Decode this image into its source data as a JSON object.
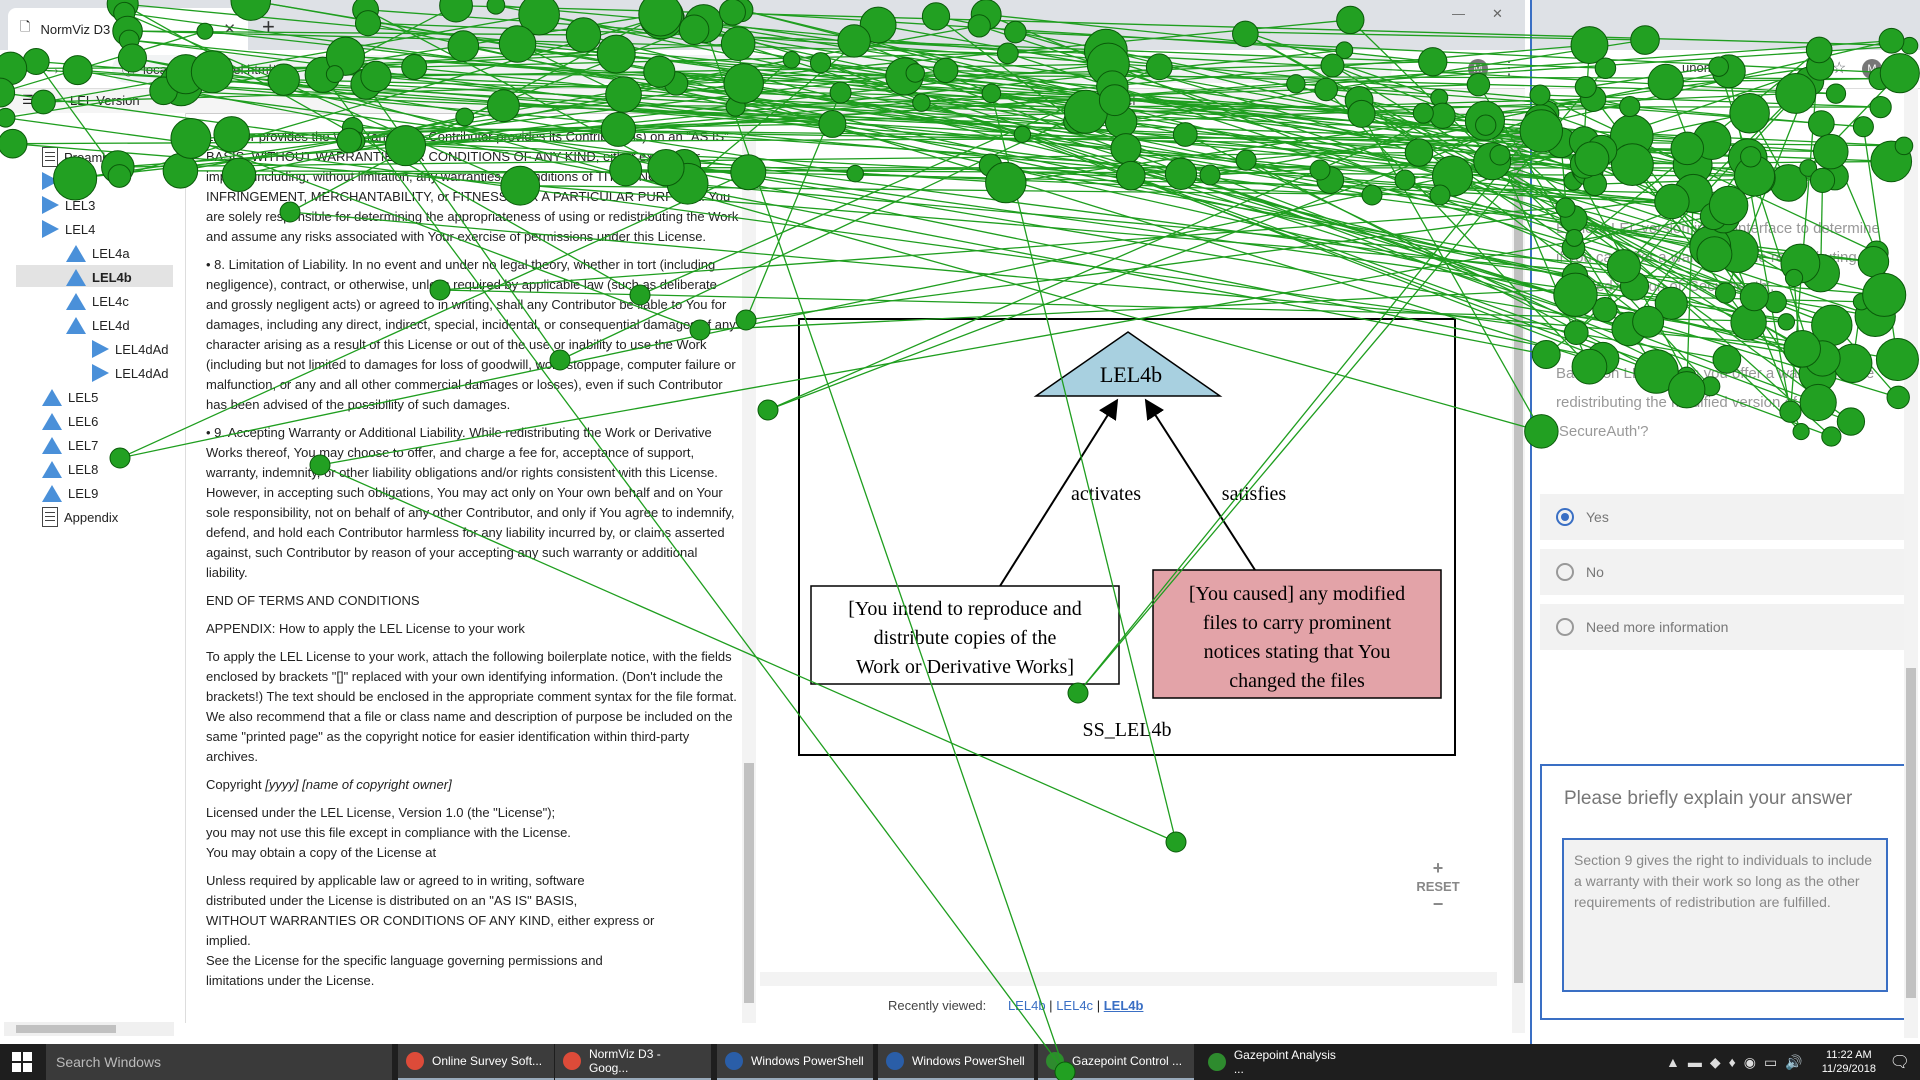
{
  "left_window": {
    "tab_title": "NormViz D3",
    "url": "localhost:3000/lel.html#",
    "profile_initial": "M",
    "app_title": "LEL Version",
    "panel_title": "Model",
    "tree": [
      {
        "label": "Preamble",
        "icon": "doc-icon"
      },
      {
        "label": "LEL2",
        "icon": "triangle-right-icon"
      },
      {
        "label": "LEL3",
        "icon": "triangle-right-icon"
      },
      {
        "label": "LEL4",
        "icon": "triangle-right-icon"
      },
      {
        "label": "LEL4a",
        "icon": "triangle-up-icon"
      },
      {
        "label": "LEL4b",
        "icon": "triangle-up-icon",
        "selected": true
      },
      {
        "label": "LEL4c",
        "icon": "triangle-up-icon"
      },
      {
        "label": "LEL4d",
        "icon": "triangle-up-icon"
      },
      {
        "label": "LEL4dAd",
        "icon": "triangle-right-icon"
      },
      {
        "label": "LEL4dAd",
        "icon": "triangle-right-icon"
      },
      {
        "label": "LEL5",
        "icon": "triangle-up-icon"
      },
      {
        "label": "LEL6",
        "icon": "triangle-up-icon"
      },
      {
        "label": "LEL7",
        "icon": "triangle-up-icon"
      },
      {
        "label": "LEL8",
        "icon": "triangle-up-icon"
      },
      {
        "label": "LEL9",
        "icon": "triangle-up-icon"
      },
      {
        "label": "Appendix",
        "icon": "doc-icon"
      }
    ],
    "license": {
      "p1": "Licensor provides the Work (and each Contributor provides its Contributions) on an \"AS IS\" BASIS, WITHOUT WARRANTIES OR CONDITIONS OF ANY KIND, either express or implied, including, without limitation, any warranties or conditions of TITLE, NON-INFRINGEMENT, MERCHANTABILITY, or FITNESS FOR A PARTICULAR PURPOSE. You are solely responsible for determining the appropriateness of using or redistributing the Work and assume any risks associated with Your exercise of permissions under this License.",
      "p8": "8. Limitation of Liability. In no event and under no legal theory, whether in tort (including negligence), contract, or otherwise, unless required by applicable law (such as deliberate and grossly negligent acts) or agreed to in writing, shall any Contributor be liable to You for damages, including any direct, indirect, special, incidental, or consequential damages of any character arising as a result of this License or out of the use or inability to use the Work (including but not limited to damages for loss of goodwill, work stoppage, computer failure or malfunction, or any and all other commercial damages or losses), even if such Contributor has been advised of the possibility of such damages.",
      "p9": "9. Accepting Warranty or Additional Liability. While redistributing the Work or Derivative Works thereof, You may choose to offer, and charge a fee for, acceptance of support, warranty, indemnity, or other liability obligations and/or rights consistent with this License. However, in accepting such obligations, You may act only on Your own behalf and on Your sole responsibility, not on behalf of any other Contributor, and only if You agree to indemnify, defend, and hold each Contributor harmless for any liability incurred by, or claims asserted against, such Contributor by reason of your accepting any such warranty or additional liability.",
      "end": "END OF TERMS AND CONDITIONS",
      "appendix_head": "APPENDIX: How to apply the LEL License to your work",
      "appendix_body": "To apply the LEL License to your work, attach the following boilerplate notice, with the fields enclosed by brackets \"[]\" replaced with your own identifying information. (Don't include the brackets!) The text should be enclosed in the appropriate comment syntax for the file format. We also recommend that a file or class name and description of purpose be included on the same \"printed page\" as the copyright notice for easier identification within third-party archives.",
      "copyright_label": "Copyright",
      "copyright_value": "[yyyy] [name of copyright owner]",
      "licensed_1": "Licensed under the LEL License, Version 1.0 (the \"License\");",
      "licensed_2": "you may not use this file except in compliance with the License.",
      "licensed_3": "You may obtain a copy of the License at",
      "unless_1": "Unless required by applicable law or agreed to in writing, software",
      "unless_2": "distributed under the License is distributed on an \"AS IS\" BASIS,",
      "unless_3": "WITHOUT WARRANTIES OR CONDITIONS OF ANY KIND, either express or",
      "unless_4": "implied.",
      "unless_5": "See the License for the specific language governing permissions and",
      "unless_6": "limitations under the License."
    },
    "graph": {
      "top_node": "LEL4b",
      "edge_left": "activates",
      "edge_right": "satisfies",
      "left_node_lines": [
        "[You intend to reproduce and",
        "distribute copies of the",
        "Work or Derivative Works]"
      ],
      "right_node_lines": [
        "[You caused] any modified",
        "files to carry prominent",
        "notices stating that You",
        "changed the files"
      ],
      "cluster_label": "SS_LEL4b",
      "top_fill": "#a8d0e0",
      "right_fill": "#e3a3a8"
    },
    "zoom": {
      "plus": "+",
      "reset": "RESET",
      "minus": "−"
    },
    "recent": {
      "label": "Recently viewed:",
      "items": [
        "LEL4b",
        "LEL4c",
        "LEL4b"
      ],
      "sep": "|"
    }
  },
  "right_window": {
    "profile_initial": "M",
    "url_fragment": "unomah...",
    "question_1": "Explore LEL version in the interface to determine if you can offer a warranty while redistributing the modified version of 'SecureAuth'.",
    "question_2": "Based on LEL4b, can you offer a warranty while redistributing the modified version of 'SecureAuth'?",
    "options": [
      {
        "label": "Yes",
        "selected": true
      },
      {
        "label": "No",
        "selected": false
      },
      {
        "label": "Need more information",
        "selected": false
      }
    ],
    "explain_label": "Please briefly explain your answer",
    "explain_value": "Section 9 gives the right to individuals to include a warranty with their work so long as the other requirements of redistribution are fulfilled."
  },
  "taskbar": {
    "search_placeholder": "Search Windows",
    "items": [
      {
        "label": "Online Survey Soft...",
        "icon": "chrome-icon"
      },
      {
        "label": "NormViz D3 - Goog...",
        "icon": "chrome-icon"
      },
      {
        "label": "Windows PowerShell",
        "icon": "powershell-icon"
      },
      {
        "label": "Windows PowerShell",
        "icon": "powershell-icon"
      },
      {
        "label": "Gazepoint Control ...",
        "icon": "gazepoint-icon"
      },
      {
        "label": "Gazepoint Analysis ...",
        "icon": "gazepoint-icon"
      }
    ],
    "time": "11:22 AM",
    "date": "11/29/2018"
  },
  "colors": {
    "gaze": "#1f9e1f",
    "link": "#3a6fc4",
    "accent": "#3a6fc4"
  }
}
